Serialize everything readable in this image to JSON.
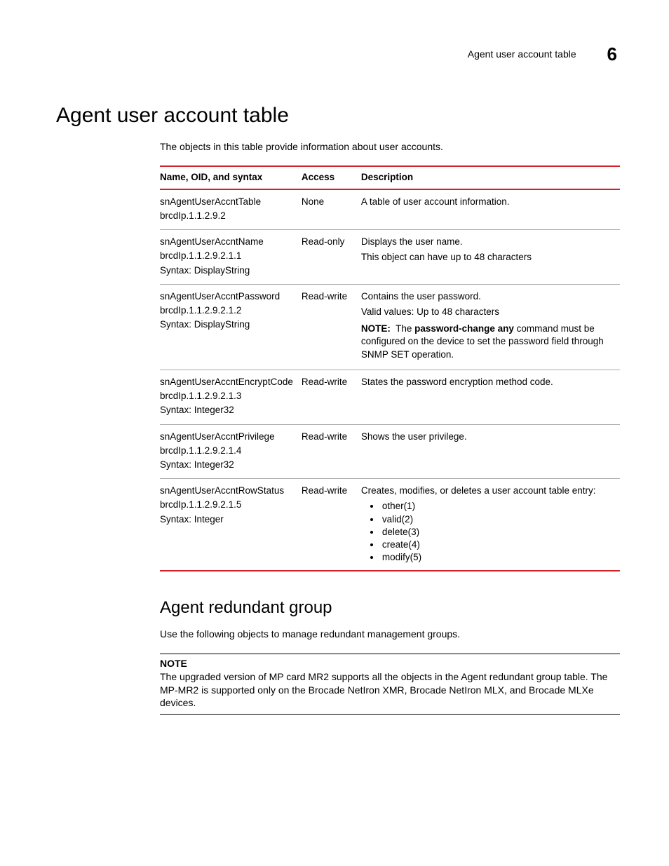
{
  "header": {
    "title": "Agent user account table",
    "chapter": "6"
  },
  "section": {
    "title": "Agent user account table",
    "intro": "The objects in this table provide information about user accounts."
  },
  "table": {
    "headers": {
      "c1": "Name, OID, and syntax",
      "c2": "Access",
      "c3": "Description"
    },
    "rows": [
      {
        "name1": "snAgentUserAccntTable",
        "name2": "brcdIp.1.1.2.9.2",
        "name3": "",
        "access": "None",
        "desc1": "A table of user account information."
      },
      {
        "name1": "snAgentUserAccntName",
        "name2": "brcdIp.1.1.2.9.2.1.1",
        "name3": "Syntax: DisplayString",
        "access": "Read-only",
        "desc1": "Displays the user name.",
        "desc2": "This object can have up to 48 characters"
      },
      {
        "name1": "snAgentUserAccntPassword",
        "name2": "brcdIp.1.1.2.9.2.1.2",
        "name3": "Syntax: DisplayString",
        "access": "Read-write",
        "desc1": "Contains the user password.",
        "desc2": "Valid values: Up to 48 characters",
        "note_label": "NOTE:",
        "note_pre": "The ",
        "note_bold": "password-change any",
        "note_post": " command must be configured on the device to set the password field through SNMP SET operation."
      },
      {
        "name1": "snAgentUserAccntEncryptCode",
        "name2": "brcdIp.1.1.2.9.2.1.3",
        "name3": "Syntax: Integer32",
        "access": "Read-write",
        "desc1": "States the password encryption method code."
      },
      {
        "name1": "snAgentUserAccntPrivilege",
        "name2": "brcdIp.1.1.2.9.2.1.4",
        "name3": "Syntax: Integer32",
        "access": "Read-write",
        "desc1": "Shows the user privilege."
      },
      {
        "name1": "snAgentUserAccntRowStatus",
        "name2": "brcdIp.1.1.2.9.2.1.5",
        "name3": "Syntax: Integer",
        "access": "Read-write",
        "desc1": "Creates, modifies, or deletes a user account table entry:",
        "bullets": [
          "other(1)",
          "valid(2)",
          "delete(3)",
          "create(4)",
          "modify(5)"
        ]
      }
    ]
  },
  "subsection": {
    "title": "Agent redundant group",
    "intro": "Use the following objects to manage redundant management groups.",
    "note_label": "NOTE",
    "note_body": "The upgraded version of MP card MR2 supports all the objects in the Agent redundant group table. The MP-MR2 is supported only on the Brocade NetIron XMR, Brocade NetIron MLX, and Brocade MLXe devices."
  }
}
